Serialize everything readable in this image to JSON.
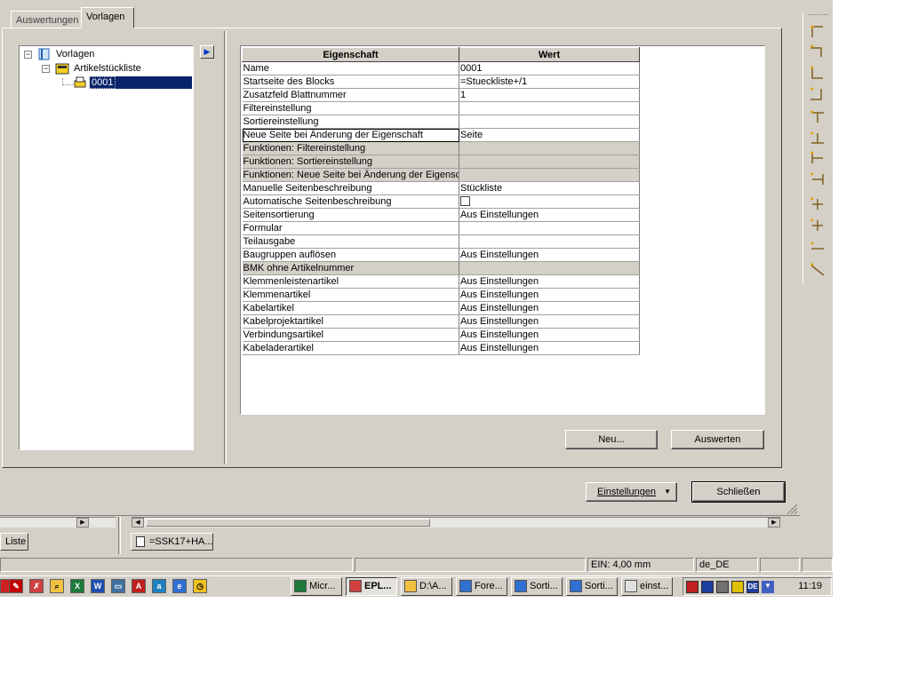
{
  "tabs": [
    {
      "label": "Auswertungen",
      "active": false
    },
    {
      "label": "Vorlagen",
      "active": true
    }
  ],
  "tree": {
    "root": {
      "label": "Vorlagen"
    },
    "child": {
      "label": "Artikelstückliste"
    },
    "leaf": {
      "label": "0001"
    }
  },
  "table": {
    "headers": {
      "property": "Eigenschaft",
      "value": "Wert"
    },
    "rows": [
      {
        "key": "Name",
        "value": "0001",
        "readonly": false
      },
      {
        "key": "Startseite des Blocks",
        "value": "=Stueckliste+/1",
        "readonly": false
      },
      {
        "key": "Zusatzfeld Blattnummer",
        "value": "1",
        "readonly": false
      },
      {
        "key": "Filtereinstellung",
        "value": "",
        "readonly": false
      },
      {
        "key": "Sortiereinstellung",
        "value": "",
        "readonly": false
      },
      {
        "key": "Neue Seite bei Änderung der Eigenschaft",
        "value": "Seite",
        "readonly": false,
        "selected": true
      },
      {
        "key": "Funktionen: Filtereinstellung",
        "value": "",
        "readonly": true
      },
      {
        "key": "Funktionen: Sortiereinstellung",
        "value": "",
        "readonly": true
      },
      {
        "key": "Funktionen: Neue Seite bei Änderung der Eigensc",
        "value": "",
        "readonly": true
      },
      {
        "key": "Manuelle Seitenbeschreibung",
        "value": "Stückliste",
        "readonly": false
      },
      {
        "key": "Automatische Seitenbeschreibung",
        "value": "",
        "readonly": false,
        "checkbox": true
      },
      {
        "key": "Seitensortierung",
        "value": "Aus Einstellungen",
        "readonly": false
      },
      {
        "key": "Formular",
        "value": "",
        "readonly": false
      },
      {
        "key": "Teilausgabe",
        "value": "",
        "readonly": false
      },
      {
        "key": "Baugruppen auflösen",
        "value": "Aus Einstellungen",
        "readonly": false
      },
      {
        "key": "BMK ohne Artikelnummer",
        "value": "",
        "readonly": true
      },
      {
        "key": "Klemmenleistenartikel",
        "value": "Aus Einstellungen",
        "readonly": false
      },
      {
        "key": "Klemmenartikel",
        "value": "Aus Einstellungen",
        "readonly": false
      },
      {
        "key": "Kabelartikel",
        "value": "Aus Einstellungen",
        "readonly": false
      },
      {
        "key": "Kabelprojektartikel",
        "value": "Aus Einstellungen",
        "readonly": false
      },
      {
        "key": "Verbindungsartikel",
        "value": "Aus Einstellungen",
        "readonly": false
      },
      {
        "key": "Kabeladerartikel",
        "value": "Aus Einstellungen",
        "readonly": false
      }
    ]
  },
  "buttons": {
    "neu": "Neu...",
    "auswerten": "Auswerten",
    "einstellungen": "Einstellungen",
    "schliessen": "Schließen"
  },
  "lower": {
    "tab_liste": "Liste",
    "doc_tab": "=SSK17+HA..."
  },
  "status": {
    "ein": "EIN: 4,00 mm",
    "locale": "de_DE"
  },
  "taskbar": {
    "tasks": [
      "Micr...",
      "EPL...",
      "D:\\A...",
      "Fore...",
      "Sorti...",
      "Sorti...",
      "einst..."
    ],
    "clock": "11:19",
    "lang": "DE"
  }
}
